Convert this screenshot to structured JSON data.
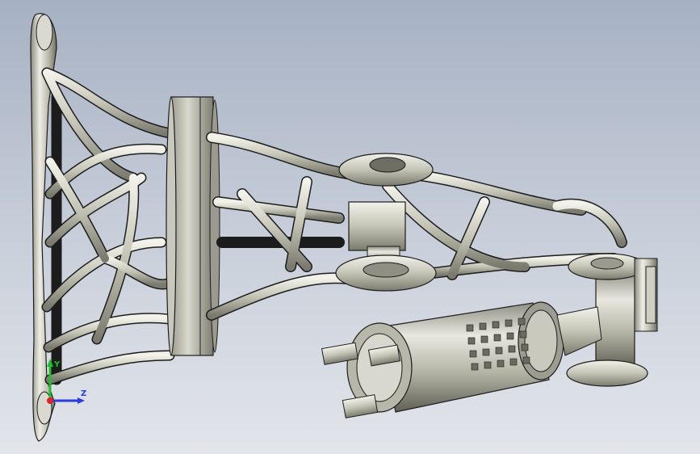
{
  "viewport": {
    "background_top": "#a6b1c3",
    "background_bottom": "#e2e5ea"
  },
  "model": {
    "metal_light": "#e4e4da",
    "metal_mid": "#b8b8aa",
    "metal_dark": "#6f6f64",
    "edge_color": "#1c1c1c"
  },
  "triad": {
    "y_label": "Y",
    "z_label": "Z",
    "y_color": "#1fbf2f",
    "z_color": "#2a3de0",
    "x_color": "#e0202a"
  }
}
